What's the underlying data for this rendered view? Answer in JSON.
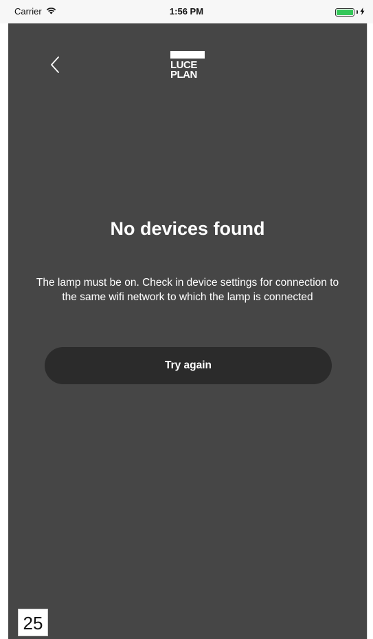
{
  "status_bar": {
    "carrier": "Carrier",
    "time": "1:56 PM",
    "wifi_icon": "wifi-icon",
    "battery_icon": "battery-charging-icon",
    "battery_color": "#34c759"
  },
  "header": {
    "back_icon": "chevron-left-icon",
    "logo_line1": "LUCE",
    "logo_line2": "PLAN"
  },
  "main": {
    "title": "No devices found",
    "message": "The lamp must be on. Check in device settings for connection to the same wifi network to which the lamp is connected",
    "button_label": "Try again"
  },
  "page_number": "25",
  "colors": {
    "background": "#464646",
    "button": "#2b2b2b",
    "text": "#ffffff"
  }
}
